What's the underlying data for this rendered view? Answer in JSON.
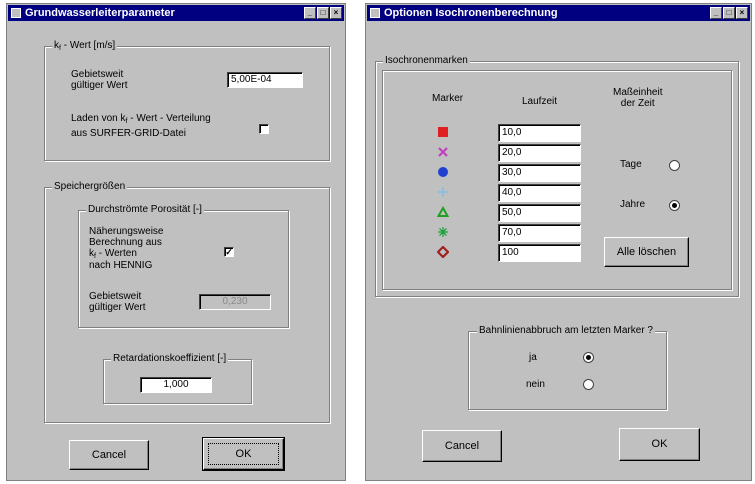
{
  "left_window": {
    "title": "Grundwasserleiterparameter",
    "kf_group": {
      "legend_k": "k",
      "legend_sub": "f",
      "legend_rest": " - Wert [m/s]",
      "gebietsweit_label_line1": "Gebietsweit",
      "gebietsweit_label_line2": "gültiger Wert",
      "kf_value": "5,00E-04",
      "laden_line1_pre": "Laden von k",
      "laden_line1_sub": "f",
      "laden_line1_post": " - Wert - Verteilung",
      "laden_line2": "aus SURFER-GRID-Datei",
      "laden_checked": ""
    },
    "speicher_group": {
      "legend": "Speichergrößen",
      "porosity_group": {
        "legend": "Durchströmte Porosität [-]",
        "naeherung_line1": "Näherungsweise",
        "naeherung_line2": "Berechnung aus",
        "naeherung_line3_pre": "k",
        "naeherung_line3_sub": "f",
        "naeherung_line3_post": " - Werten",
        "naeherung_line4": "nach HENNIG",
        "naeherung_checked": "✓",
        "gebietsweit_line1": "Gebietsweit",
        "gebietsweit_line2": "gültiger Wert",
        "porosity_value": "0,230"
      },
      "retardation_group": {
        "legend": "Retardationskoeffizient [-]",
        "value": "1,000"
      }
    },
    "cancel_label": "Cancel",
    "ok_label": "OK"
  },
  "right_window": {
    "title": "Optionen Isochronenberechnung",
    "isochronen_group": {
      "legend": "Isochronenmarken",
      "col_marker": "Marker",
      "col_laufzeit": "Laufzeit",
      "col_einheit_line1": "Maßeinheit",
      "col_einheit_line2": "der Zeit",
      "rows": [
        {
          "marker": "square-marker-icon",
          "color": "#e02020",
          "value": "10,0"
        },
        {
          "marker": "cross-marker-icon",
          "color": "#c040c0",
          "value": "20,0"
        },
        {
          "marker": "circle-marker-icon",
          "color": "#2040d0",
          "value": "30,0"
        },
        {
          "marker": "plus-marker-icon",
          "color": "#80c0e0",
          "value": "40,0"
        },
        {
          "marker": "triangle-marker-icon",
          "color": "#20a020",
          "value": "50,0"
        },
        {
          "marker": "asterisk-marker-icon",
          "color": "#20a040",
          "value": "70,0"
        },
        {
          "marker": "diamond-marker-icon",
          "color": "#a02020",
          "value": "100"
        }
      ],
      "unit_tage_label": "Tage",
      "unit_tage_selected": false,
      "unit_jahre_label": "Jahre",
      "unit_jahre_selected": true,
      "clear_all_label": "Alle löschen"
    },
    "abbruch_group": {
      "legend": "Bahnlinienabbruch am letzten Marker ?",
      "ja_label": "ja",
      "ja_selected": true,
      "nein_label": "nein",
      "nein_selected": false
    },
    "cancel_label": "Cancel",
    "ok_label": "OK"
  }
}
